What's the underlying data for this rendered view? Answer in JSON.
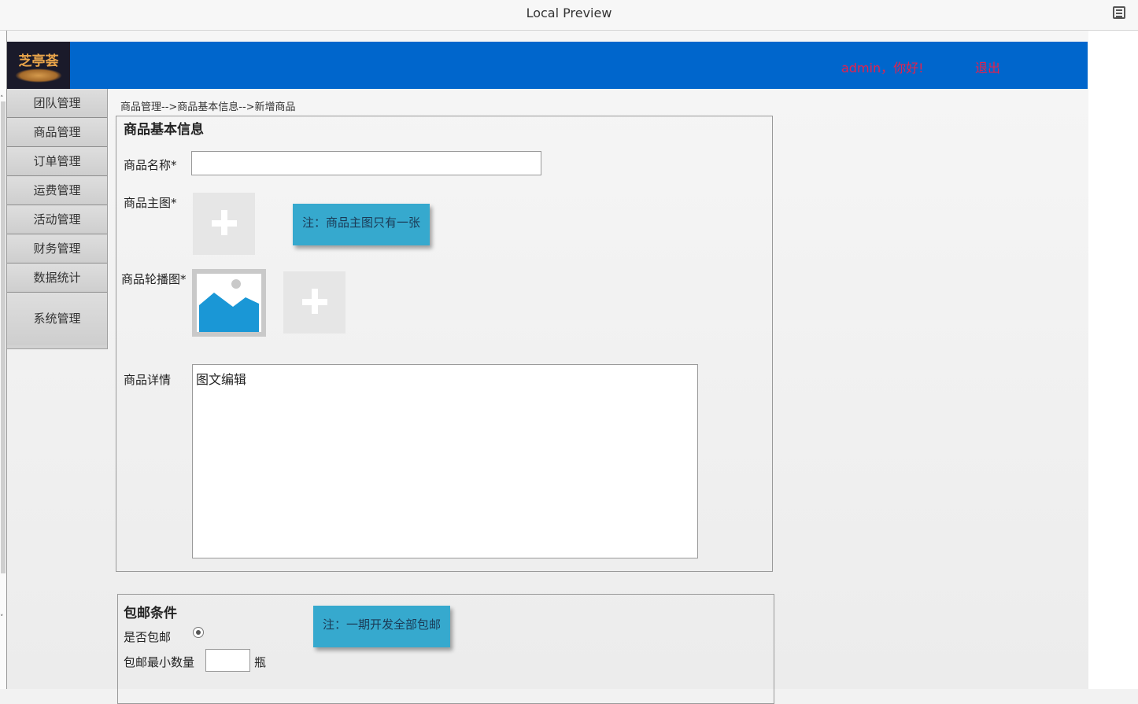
{
  "window": {
    "title": "Local Preview",
    "menu_icon": "list-icon"
  },
  "header": {
    "logo_text": "芝亭荟",
    "greeting": "admin，你好!",
    "logout": "退出",
    "bg_color": "#0066cc",
    "text_color": "#e8204a"
  },
  "sidebar": {
    "items": [
      {
        "label": "团队管理"
      },
      {
        "label": "商品管理"
      },
      {
        "label": "订单管理"
      },
      {
        "label": "运费管理"
      },
      {
        "label": "活动管理"
      },
      {
        "label": "财务管理"
      },
      {
        "label": "数据统计"
      },
      {
        "label": "系统管理"
      }
    ]
  },
  "breadcrumb": "商品管理-->商品基本信息-->新增商品",
  "basic_info": {
    "title": "商品基本信息",
    "name_label": "商品名称*",
    "name_value": "",
    "main_image_label": "商品主图*",
    "main_image_note": "注：商品主图只有一张",
    "carousel_label": "商品轮播图*",
    "detail_label": "商品详情",
    "detail_placeholder": "图文编辑"
  },
  "shipping": {
    "title": "包邮条件",
    "free_label": "是否包邮",
    "note": "注：一期开发全部包邮",
    "min_qty_label": "包邮最小数量",
    "min_qty_value": "",
    "unit": "瓶"
  },
  "colors": {
    "note_bg": "#36a9ce",
    "sidebar_bg": "#d2d2d2"
  }
}
